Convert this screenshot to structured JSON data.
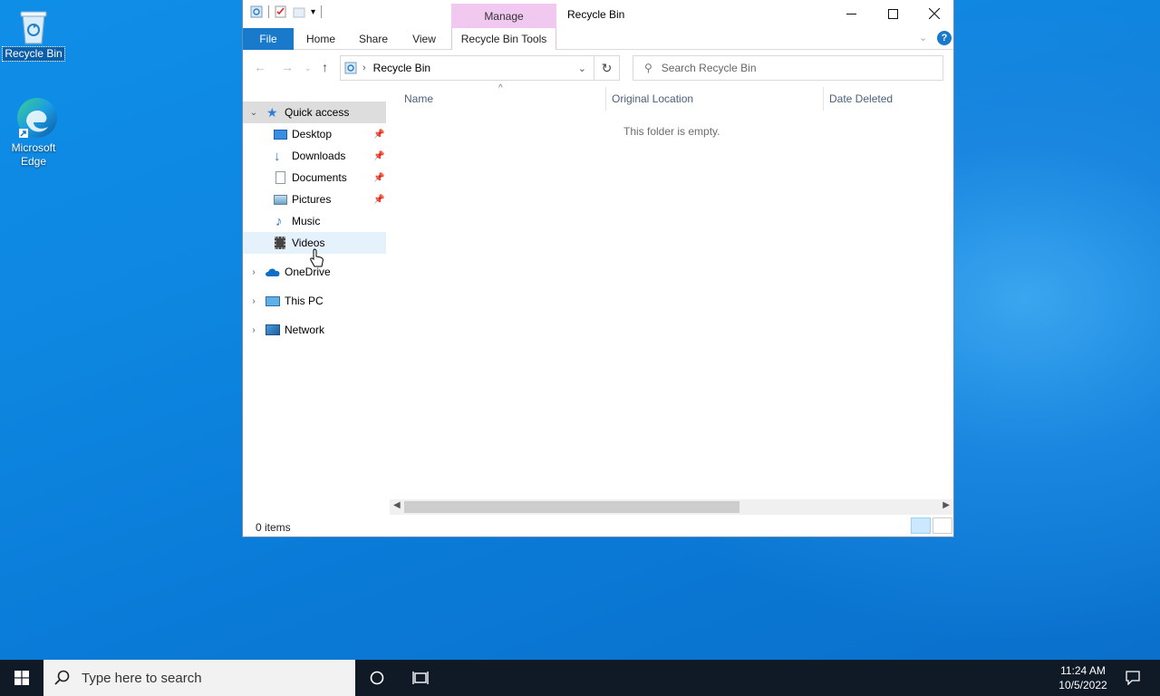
{
  "desktop": {
    "icons": [
      {
        "label": "Recycle Bin",
        "icon": "recycle-bin-icon"
      },
      {
        "label_line1": "Microsoft",
        "label_line2": "Edge",
        "icon": "edge-icon"
      }
    ]
  },
  "window": {
    "title": "Recycle Bin",
    "contextual_tab_group": "Manage",
    "ribbon_tabs": [
      "File",
      "Home",
      "Share",
      "View",
      "Recycle Bin Tools"
    ],
    "address": {
      "path": "Recycle Bin"
    },
    "search": {
      "placeholder": "Search Recycle Bin"
    },
    "nav_pane": {
      "quick_access": "Quick access",
      "pinned": [
        {
          "label": "Desktop",
          "icon": "desktop-folder-icon",
          "pinned": true
        },
        {
          "label": "Downloads",
          "icon": "downloads-icon",
          "pinned": true
        },
        {
          "label": "Documents",
          "icon": "documents-icon",
          "pinned": true
        },
        {
          "label": "Pictures",
          "icon": "pictures-icon",
          "pinned": true
        },
        {
          "label": "Music",
          "icon": "music-icon",
          "pinned": false
        },
        {
          "label": "Videos",
          "icon": "videos-icon",
          "pinned": false
        }
      ],
      "roots": [
        {
          "label": "OneDrive",
          "icon": "onedrive-icon"
        },
        {
          "label": "This PC",
          "icon": "this-pc-icon"
        },
        {
          "label": "Network",
          "icon": "network-icon"
        }
      ]
    },
    "columns": [
      "Name",
      "Original Location",
      "Date Deleted"
    ],
    "empty_message": "This folder is empty.",
    "status": "0 items"
  },
  "taskbar": {
    "search_placeholder": "Type here to search",
    "time": "11:24 AM",
    "date": "10/5/2022"
  },
  "colors": {
    "accent": "#1979ca",
    "manage_tab": "#f0c8f0",
    "taskbar": "#101a26"
  }
}
